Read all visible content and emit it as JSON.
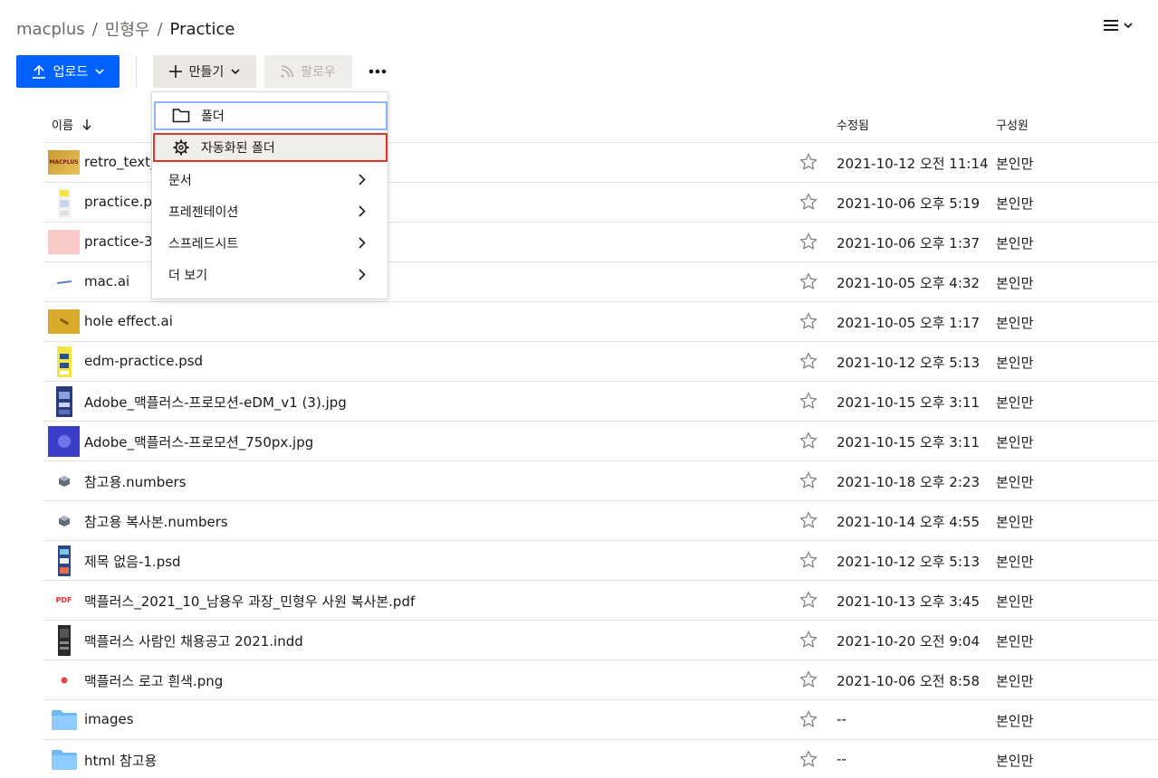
{
  "breadcrumb": {
    "root": "macplus",
    "middle": "민형우",
    "current": "Practice",
    "separator": "/"
  },
  "toolbar": {
    "upload_label": "업로드",
    "create_label": "만들기",
    "follow_label": "팔로우"
  },
  "create_menu": {
    "folder_label": "폴더",
    "auto_folder_label": "자동화된 폴더",
    "document_label": "문서",
    "presentation_label": "프레젠테이션",
    "spreadsheet_label": "스프레드시트",
    "more_label": "더 보기"
  },
  "table": {
    "col_name": "이름",
    "col_modified": "수정됨",
    "col_members": "구성원",
    "rows": [
      {
        "name": "retro_text_",
        "modified": "2021-10-12 오전 11:14",
        "members": "본인만",
        "thumb": "retro-thumb"
      },
      {
        "name": "practice.ps",
        "modified": "2021-10-06 오후 5:19",
        "members": "본인만",
        "thumb": "psd-thumb"
      },
      {
        "name": "practice-3",
        "modified": "2021-10-06 오후 1:37",
        "members": "본인만",
        "thumb": "pink-thumb"
      },
      {
        "name": "mac.ai",
        "modified": "2021-10-05 오후 4:32",
        "members": "본인만",
        "thumb": "ai-thumb"
      },
      {
        "name": "hole effect.ai",
        "modified": "2021-10-05 오후 1:17",
        "members": "본인만",
        "thumb": "gold-thumb"
      },
      {
        "name": "edm-practice.psd",
        "modified": "2021-10-12 오후 5:13",
        "members": "본인만",
        "thumb": "edm-thumb"
      },
      {
        "name": "Adobe_맥플러스-프로모션-eDM_v1 (3).jpg",
        "modified": "2021-10-15 오후 3:11",
        "members": "본인만",
        "thumb": "edm-blue-thumb"
      },
      {
        "name": "Adobe_맥플러스-프로모션_750px.jpg",
        "modified": "2021-10-15 오후 3:11",
        "members": "본인만",
        "thumb": "promo-thumb"
      },
      {
        "name": "참고용.numbers",
        "modified": "2021-10-18 오후 2:23",
        "members": "본인만",
        "thumb": "numbers-thumb"
      },
      {
        "name": "참고용 복사본.numbers",
        "modified": "2021-10-14 오후 4:55",
        "members": "본인만",
        "thumb": "numbers-thumb"
      },
      {
        "name": "제목 없음-1.psd",
        "modified": "2021-10-12 오후 5:13",
        "members": "본인만",
        "thumb": "psd2-thumb"
      },
      {
        "name": "맥플러스_2021_10_남용우 과장_민형우 사원 복사본.pdf",
        "modified": "2021-10-13 오후 3:45",
        "members": "본인만",
        "thumb": "pdf-thumb"
      },
      {
        "name": "맥플러스 사람인 채용공고 2021.indd",
        "modified": "2021-10-20 오전 9:04",
        "members": "본인만",
        "thumb": "indd-thumb"
      },
      {
        "name": "맥플러스 로고 흰색.png",
        "modified": "2021-10-06 오전 8:58",
        "members": "본인만",
        "thumb": "png-thumb"
      },
      {
        "name": "images",
        "modified": "--",
        "members": "본인만",
        "thumb": "folder"
      },
      {
        "name": "html 참고용",
        "modified": "--",
        "members": "본인만",
        "thumb": "folder"
      }
    ]
  },
  "colors": {
    "accent": "#0061fe",
    "highlight_red": "#e0322f",
    "focus_blue": "#8fb3f7"
  },
  "thumb_labels": {
    "retro": "MACPLUS",
    "pdf": "PDF"
  }
}
